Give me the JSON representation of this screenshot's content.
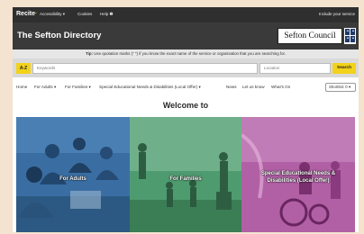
{
  "topbar": {
    "logo": "Recite",
    "menu": [
      "Accessibility ▾",
      "Cookies",
      "Help ❷"
    ],
    "include_link": "Include your service"
  },
  "header": {
    "site_title": "The Sefton Directory",
    "council_name": "Sefton Council"
  },
  "tip": {
    "label": "Tip:",
    "text": " Use quotation marks (\" \") if you know the exact name of the service or organisation that you are searching for."
  },
  "search": {
    "az_label": "A-Z",
    "keywords_placeholder": "Keywords",
    "location_placeholder": "Location",
    "button_label": "Search"
  },
  "nav": {
    "items": [
      "Home",
      "For Adults ▾",
      "For Families ▾",
      "Special Educational Needs & Disabilities (Local Offer) ▾",
      "News",
      "Let us know",
      "What's On"
    ],
    "shortlist": "Shortlist: 0 ▾"
  },
  "welcome": "Welcome to",
  "cards": [
    {
      "label": "For Adults",
      "color": "#2f5f8f"
    },
    {
      "label": "For Families",
      "color": "#3e8c62"
    },
    {
      "label_line1": "Special Educational Needs &",
      "label_line2": "Disabilities (Local Offer)",
      "color": "#a3519a"
    }
  ],
  "colors": {
    "accent_yellow": "#f2d21a",
    "header_dark": "#3a3a3a"
  }
}
